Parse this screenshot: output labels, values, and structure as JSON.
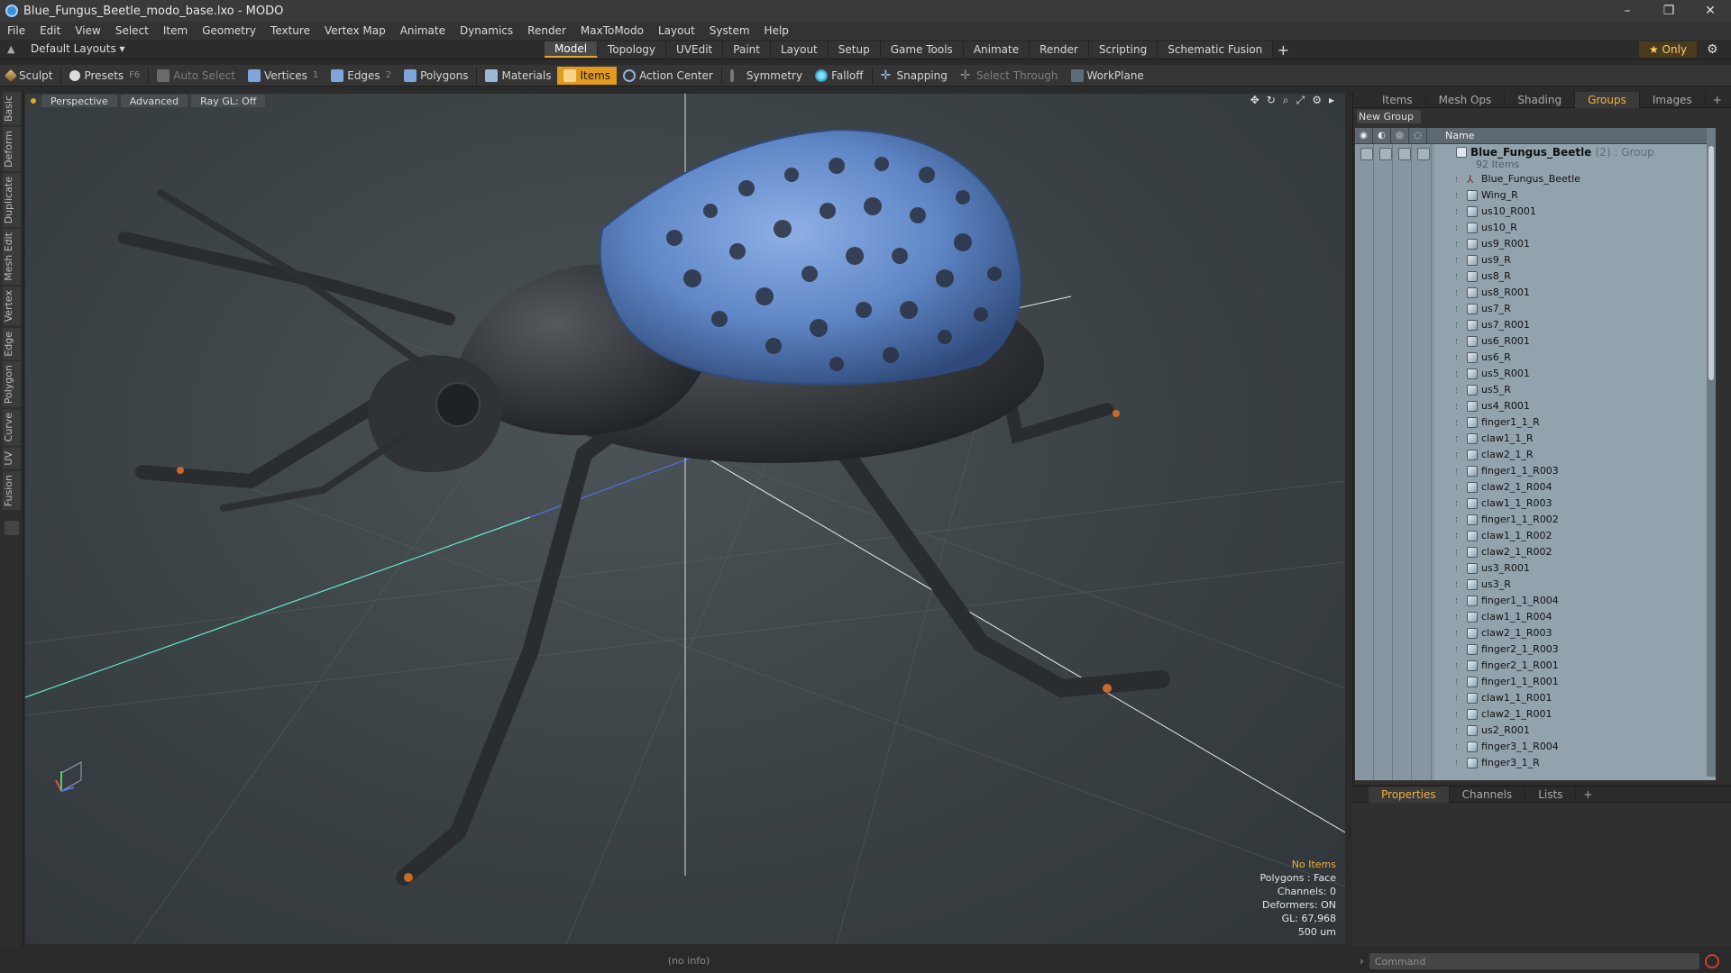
{
  "window": {
    "title": "Blue_Fungus_Beetle_modo_base.lxo - MODO",
    "controls": [
      "–",
      "❐",
      "✕"
    ]
  },
  "menu": [
    "File",
    "Edit",
    "View",
    "Select",
    "Item",
    "Geometry",
    "Texture",
    "Vertex Map",
    "Animate",
    "Dynamics",
    "Render",
    "MaxToModo",
    "Layout",
    "System",
    "Help"
  ],
  "layouts": {
    "label": "Default Layouts"
  },
  "main_tabs": [
    "Model",
    "Topology",
    "UVEdit",
    "Paint",
    "Layout",
    "Setup",
    "Game Tools",
    "Animate",
    "Render",
    "Scripting",
    "Schematic Fusion"
  ],
  "main_tab_active": "Model",
  "only_label": "★ Only",
  "toolbar": {
    "sculpt": "Sculpt",
    "presets": "Presets",
    "presets_hint": "F6",
    "auto_select": "Auto Select",
    "vertices": "Vertices",
    "vertices_hint": "1",
    "edges": "Edges",
    "edges_hint": "2",
    "polygons": "Polygons",
    "materials": "Materials",
    "items": "Items",
    "action_center": "Action Center",
    "symmetry": "Symmetry",
    "falloff": "Falloff",
    "snapping": "Snapping",
    "select_through": "Select Through",
    "workplane": "WorkPlane"
  },
  "left_tabs": [
    "Basic",
    "Deform",
    "Duplicate",
    "Mesh Edit",
    "Vertex",
    "Edge",
    "Polygon",
    "Curve",
    "UV",
    "Fusion"
  ],
  "viewport": {
    "view": "Perspective",
    "shading": "Advanced",
    "raygl": "Ray GL: Off",
    "info": {
      "no_items": "No Items",
      "polygons": "Polygons : Face",
      "channels": "Channels: 0",
      "deformers": "Deformers: ON",
      "gl": "GL: 67,968",
      "scale": "500 um"
    }
  },
  "status": "(no info)",
  "right_panel": {
    "tabs": [
      "Items",
      "Mesh Ops",
      "Shading",
      "Groups",
      "Images"
    ],
    "active_tab": "Groups",
    "new_group": "New Group",
    "column_name": "Name",
    "group": {
      "name": "Blue_Fungus_Beetle",
      "meta": "(2) : Group",
      "count": "92 Items"
    },
    "items": [
      "Blue_Fungus_Beetle",
      "Wing_R",
      "us10_R001",
      "us10_R",
      "us9_R001",
      "us9_R",
      "us8_R",
      "us8_R001",
      "us7_R",
      "us7_R001",
      "us6_R001",
      "us6_R",
      "us5_R001",
      "us5_R",
      "us4_R001",
      "finger1_1_R",
      "claw1_1_R",
      "claw2_1_R",
      "finger1_1_R003",
      "claw2_1_R004",
      "claw1_1_R003",
      "finger1_1_R002",
      "claw1_1_R002",
      "claw2_1_R002",
      "us3_R001",
      "us3_R",
      "finger1_1_R004",
      "claw1_1_R004",
      "claw2_1_R003",
      "finger2_1_R003",
      "finger2_1_R001",
      "finger1_1_R001",
      "claw1_1_R001",
      "claw2_1_R001",
      "us2_R001",
      "finger3_1_R004",
      "finger3_1_R"
    ]
  },
  "props_panel": {
    "tabs": [
      "Properties",
      "Channels",
      "Lists"
    ],
    "active_tab": "Properties"
  },
  "command": {
    "placeholder": "Command"
  },
  "colors": {
    "accent": "#e09a1f",
    "active_tab_text": "#f0b23b",
    "tree_bg": "#93a3ad",
    "shell_blue": "#5f86c6",
    "body_black": "#2a2d30"
  }
}
